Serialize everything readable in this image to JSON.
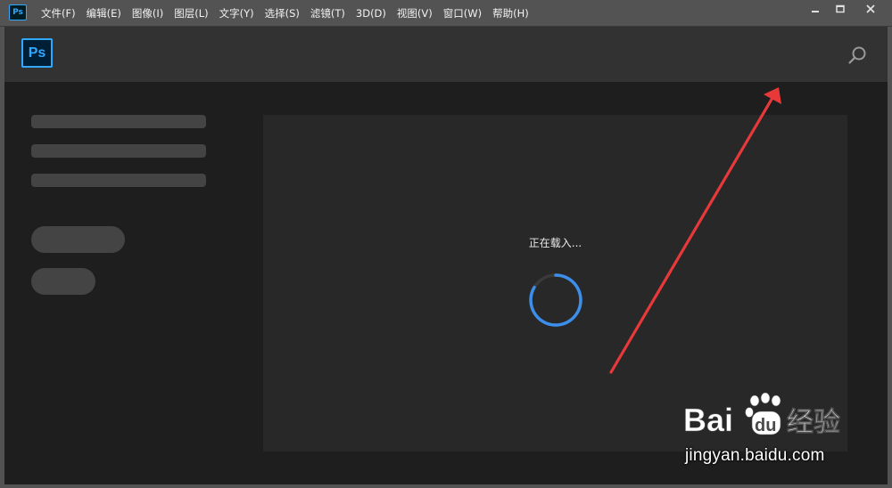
{
  "app": {
    "icon_text": "Ps",
    "logo_text": "Ps",
    "accent_color": "#31a8ff"
  },
  "menu": [
    {
      "label": "文件(F)"
    },
    {
      "label": "编辑(E)"
    },
    {
      "label": "图像(I)"
    },
    {
      "label": "图层(L)"
    },
    {
      "label": "文字(Y)"
    },
    {
      "label": "选择(S)"
    },
    {
      "label": "滤镜(T)"
    },
    {
      "label": "3D(D)"
    },
    {
      "label": "视图(V)"
    },
    {
      "label": "窗口(W)"
    },
    {
      "label": "帮助(H)"
    }
  ],
  "window_controls": {
    "minimize_icon": "minimize-icon",
    "maximize_icon": "maximize-icon",
    "close_icon": "close-icon"
  },
  "header": {
    "search_icon": "search-icon"
  },
  "content": {
    "loading_text": "正在载入...",
    "spinner_color": "#3b8eea"
  },
  "annotation": {
    "arrow_color": "#e8393a"
  },
  "watermark": {
    "brand_logo": "Baidu 经验",
    "url": "jingyan.baidu.com"
  }
}
